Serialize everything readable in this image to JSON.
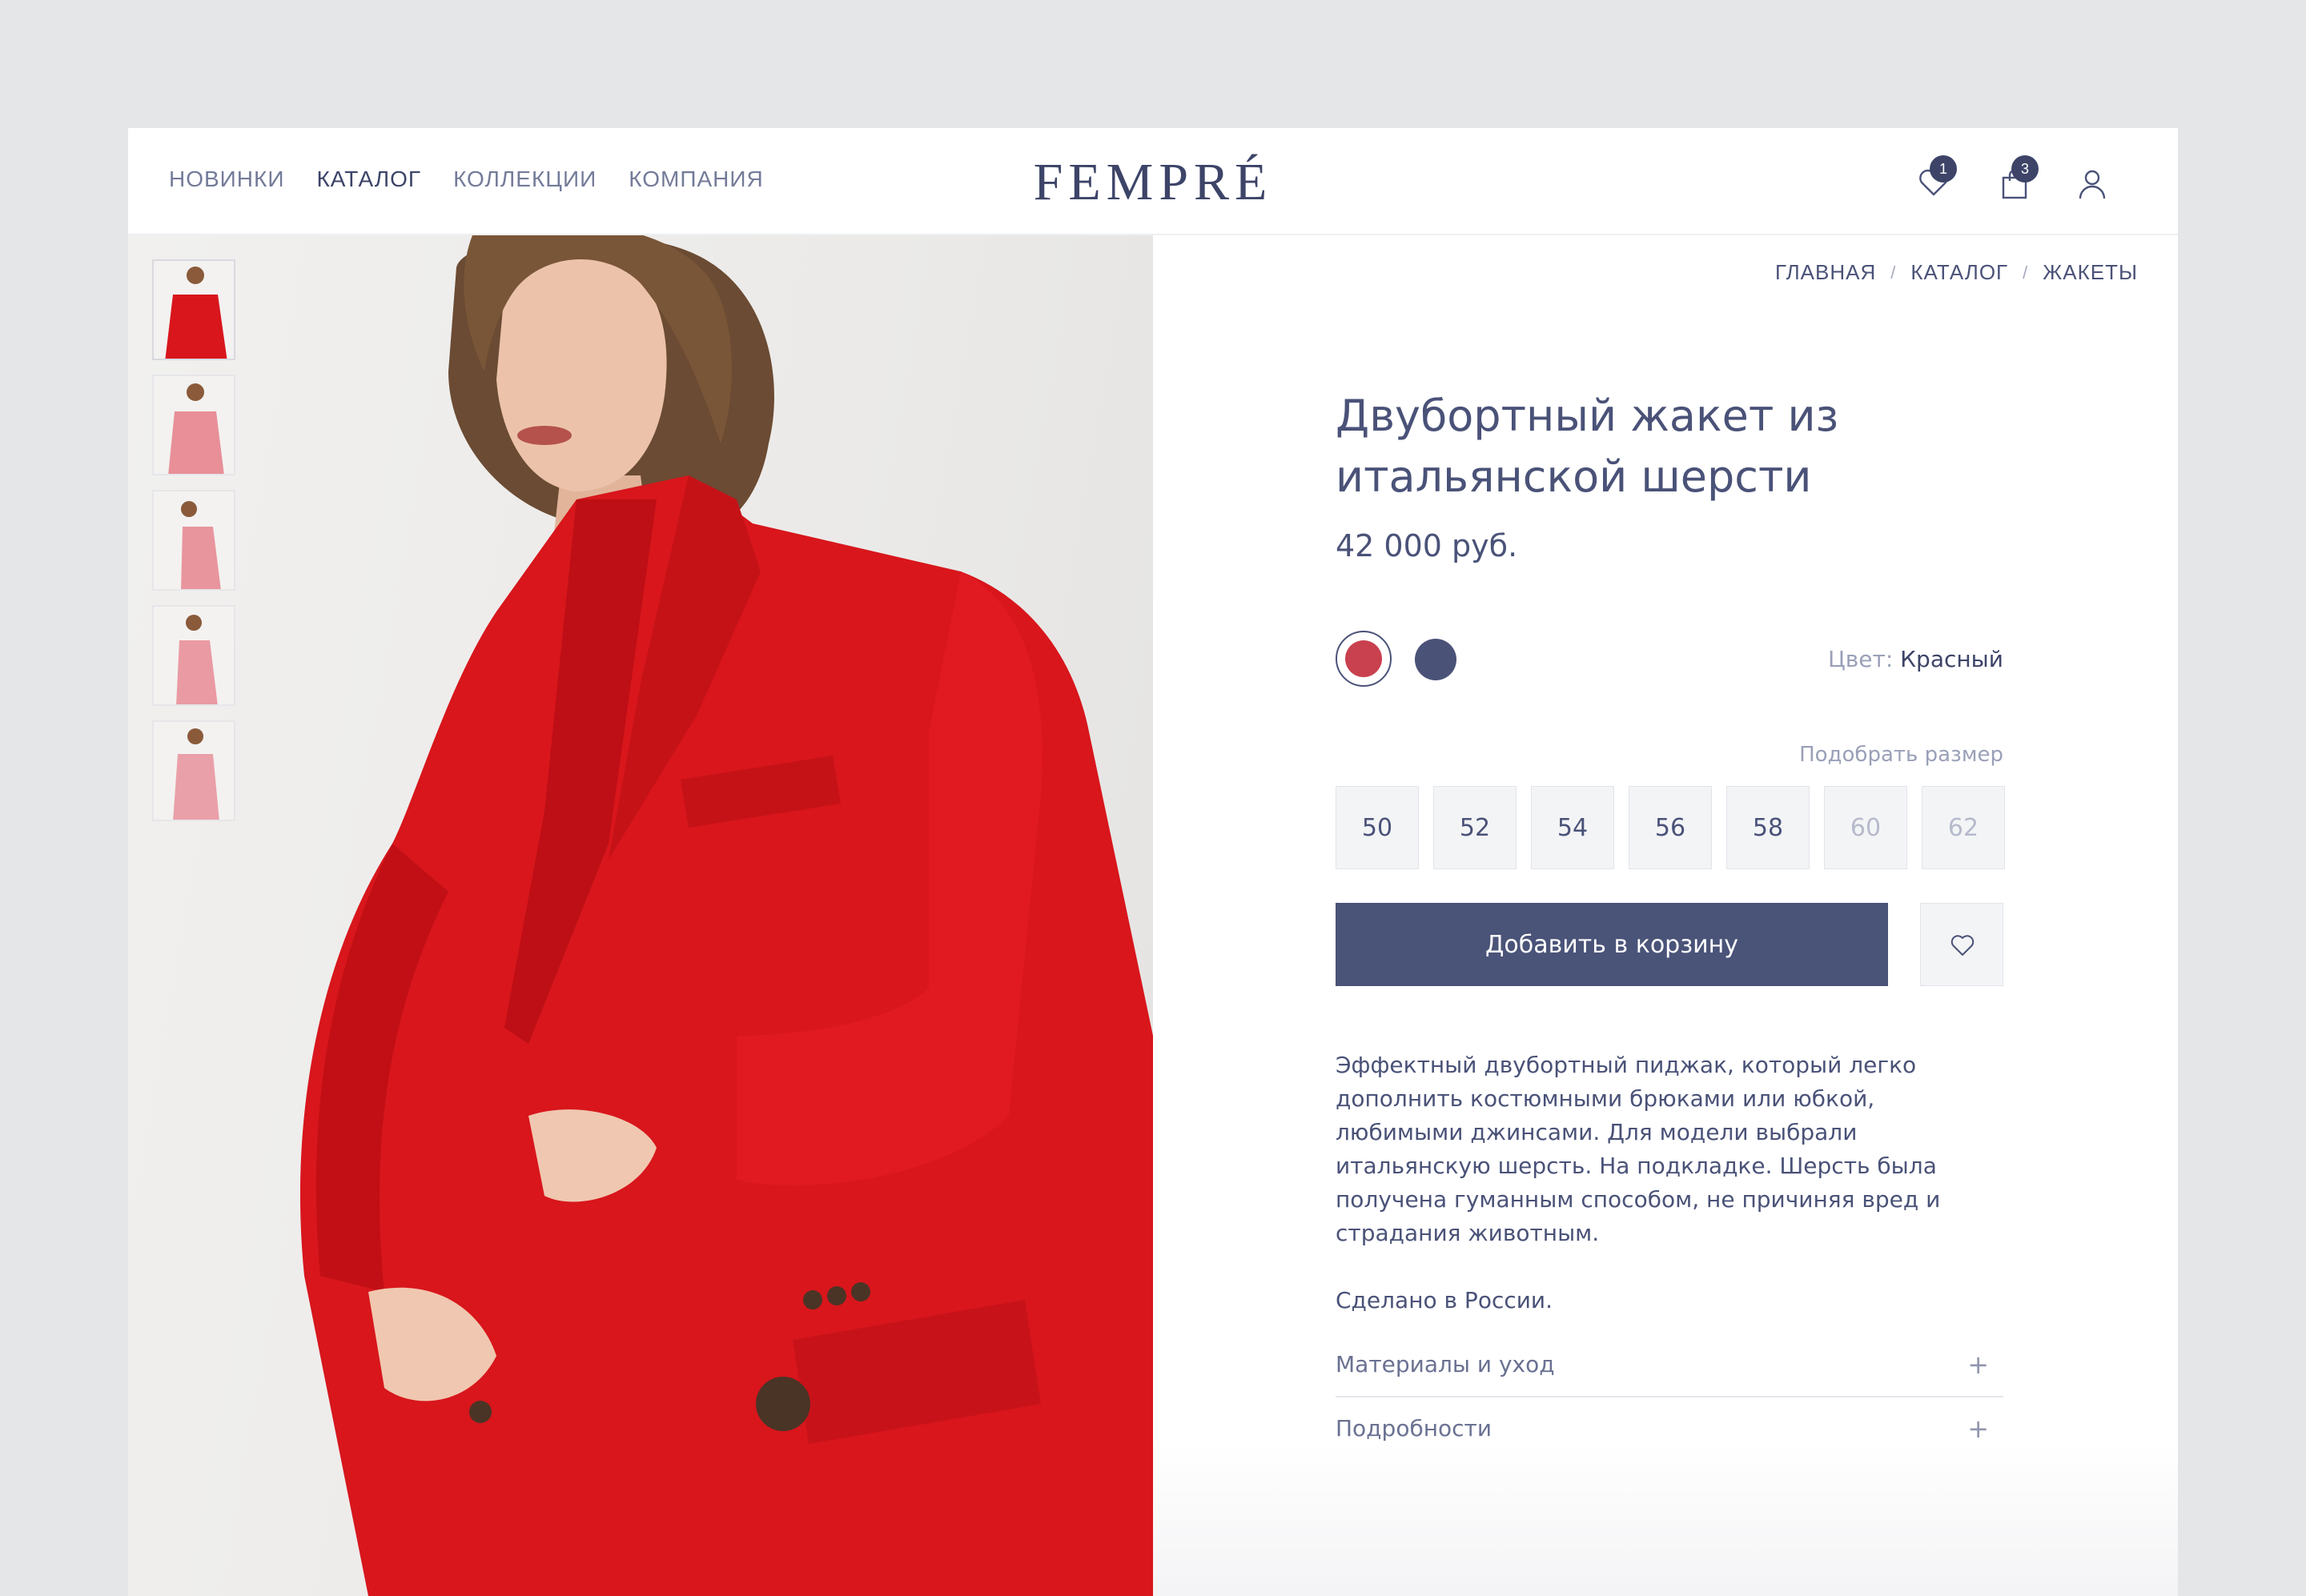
{
  "header": {
    "nav": [
      "НОВИНКИ",
      "КАТАЛОГ",
      "КОЛЛЕКЦИИ",
      "КОМПАНИЯ"
    ],
    "active_nav": "КАТАЛОГ",
    "logo": "FEMPRÉ",
    "wishlist_count": "1",
    "cart_count": "3"
  },
  "breadcrumb": [
    "ГЛАВНАЯ",
    "КАТАЛОГ",
    "ЖАКЕТЫ"
  ],
  "breadcrumb_separator": "/",
  "product": {
    "title_line1": "Двубортный жакет из",
    "title_line2": "итальянской шерсти",
    "price": "42 000 руб.",
    "color_label": "Цвет:",
    "color_value": "Красный",
    "colors": [
      {
        "name": "red",
        "hex": "#c9414e",
        "selected": true
      },
      {
        "name": "navy",
        "hex": "#4a5278",
        "selected": false
      }
    ],
    "size_help": "Подобрать размер",
    "sizes": [
      {
        "label": "50",
        "available": true
      },
      {
        "label": "52",
        "available": true
      },
      {
        "label": "54",
        "available": true
      },
      {
        "label": "56",
        "available": true
      },
      {
        "label": "58",
        "available": true
      },
      {
        "label": "60",
        "available": false
      },
      {
        "label": "62",
        "available": false
      }
    ],
    "add_to_cart": "Добавить в корзину",
    "description": [
      "Эффектный двубортный пиджак, который легко дополнить костюмными брюками или юбкой, любимыми джинсами. Для модели выбрали итальянскую шерсть. На подкладке. Шерсть была получена гуманным способом, не причиняя вред и страдания животным.",
      "Сделано в России."
    ],
    "accordion": [
      {
        "label": "Материалы и уход",
        "icon": "+"
      },
      {
        "label": "Подробности",
        "icon": "+"
      }
    ]
  },
  "colors": {
    "primary": "#4a5378",
    "text": "#4a5278",
    "jacket_red": "#d8161c",
    "background": "#e5e6e8"
  },
  "icons": [
    "heart-icon",
    "bag-icon",
    "user-icon"
  ]
}
